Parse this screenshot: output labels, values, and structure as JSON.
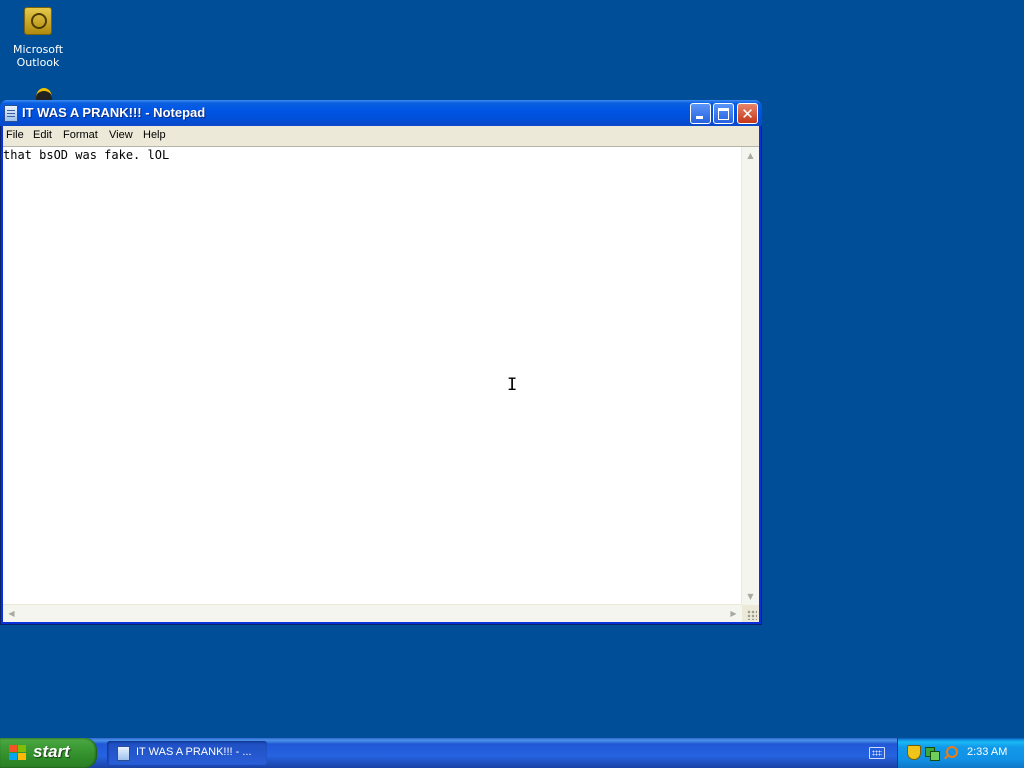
{
  "desktop": {
    "icons": [
      {
        "label": "Microsoft Outlook",
        "icon": "outlook-icon"
      },
      {
        "label": "",
        "icon": "partial-desktop-icon"
      }
    ]
  },
  "window": {
    "title": "IT WAS A PRANK!!! - Notepad",
    "icon": "notepad-icon",
    "controls": {
      "minimize": "minimize-icon",
      "maximize": "maximize-icon",
      "close": "close-icon"
    },
    "menu": [
      "File",
      "Edit",
      "Format",
      "View",
      "Help"
    ],
    "content": "that bsOD was fake. lOL"
  },
  "taskbar": {
    "start_label": "start",
    "task_button_label": "IT WAS A PRANK!!! - ...",
    "clock": "2:33 AM",
    "tray_icons": [
      "keyboard-icon",
      "security-shield-icon",
      "network-icon",
      "search-icon"
    ],
    "colors": {
      "taskbar": "#245edb",
      "start": "#3c9a35",
      "desktop": "#004e98",
      "tray": "#1291e6"
    }
  }
}
